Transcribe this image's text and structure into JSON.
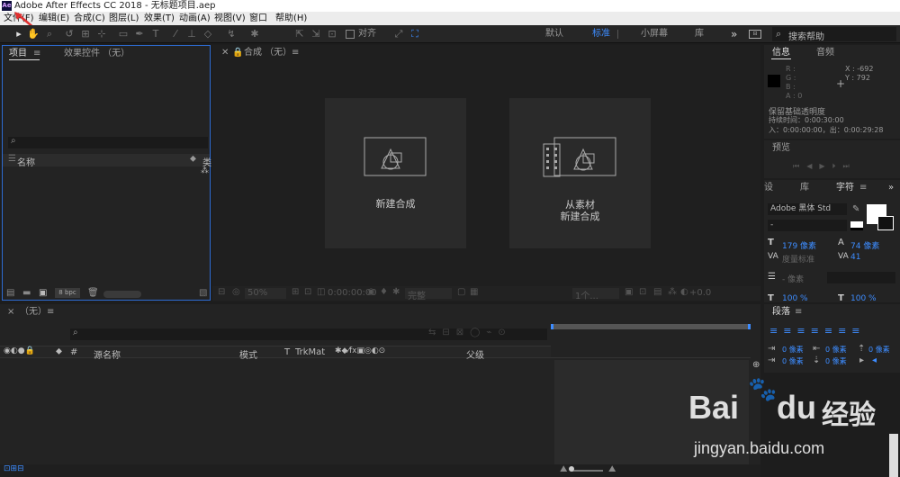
{
  "titlebar": {
    "logo": "Ae",
    "title": "Adobe After Effects CC 2018 - 无标题项目.aep"
  },
  "menu": [
    "文件(F)",
    "编辑(E)",
    "合成(C)",
    "图层(L)",
    "效果(T)",
    "动画(A)",
    "视图(V)",
    "窗口",
    "帮助(H)"
  ],
  "toolbar": {
    "snap_label": "对齐",
    "workspaces": [
      "默认",
      "标准",
      "小屏幕",
      "库"
    ],
    "more": "»",
    "search_placeholder": "搜索帮助"
  },
  "project_panel": {
    "tab_project": "项目",
    "tab_effects": "效果控件 （无）",
    "col_name": "名称",
    "col_type": "类",
    "bpc": "8 bpc"
  },
  "comp_panel": {
    "tab": "合成 （无）",
    "card1": "新建合成",
    "card2_line1": "从素材",
    "card2_line2": "新建合成",
    "zoom": "50%",
    "timecode": "0:00:00:00",
    "quality": "完整",
    "view": "1个...",
    "exposure": "+0.0"
  },
  "info_panel": {
    "tab_info": "信息",
    "tab_audio": "音频",
    "r": "R :",
    "g": "G :",
    "b": "B :",
    "a": "A : 0",
    "x": "X : -692",
    "y": "Y : 792",
    "line1": "保留基础透明度",
    "line2": "持续时间：0:00:30:00",
    "line3": "入：0:00:00:00，出：0:00:29:28"
  },
  "preview_panel": {
    "tab": "预览"
  },
  "char_panel": {
    "tab_prefix": "设",
    "tab_lib": "库",
    "tab_char": "字符",
    "font": "Adobe 黑体 Std",
    "style": "-",
    "size": "179 像素",
    "leading": "74 像素",
    "kerning": "度量标准",
    "tracking": "41",
    "stroke": "- 像素",
    "vscale": "100 %",
    "hscale": "100 %"
  },
  "para_panel": {
    "tab": "段落",
    "indent1": "0 像素",
    "indent2": "0 像素",
    "indent3": "0 像素",
    "space1": "0 像素",
    "space2": "0 像素"
  },
  "timeline": {
    "tab": "（无）",
    "col_source": "源名称",
    "col_mode": "模式",
    "col_t": "T",
    "col_trkmat": "TrkMat",
    "col_parent": "父级",
    "col_hash": "#"
  },
  "watermark": {
    "brand": "Bai",
    "brand2": "du",
    "cn": "经验",
    "url": "jingyan.baidu.com"
  },
  "colors": {
    "accent": "#3d8cff",
    "annotation": "#e03030"
  }
}
